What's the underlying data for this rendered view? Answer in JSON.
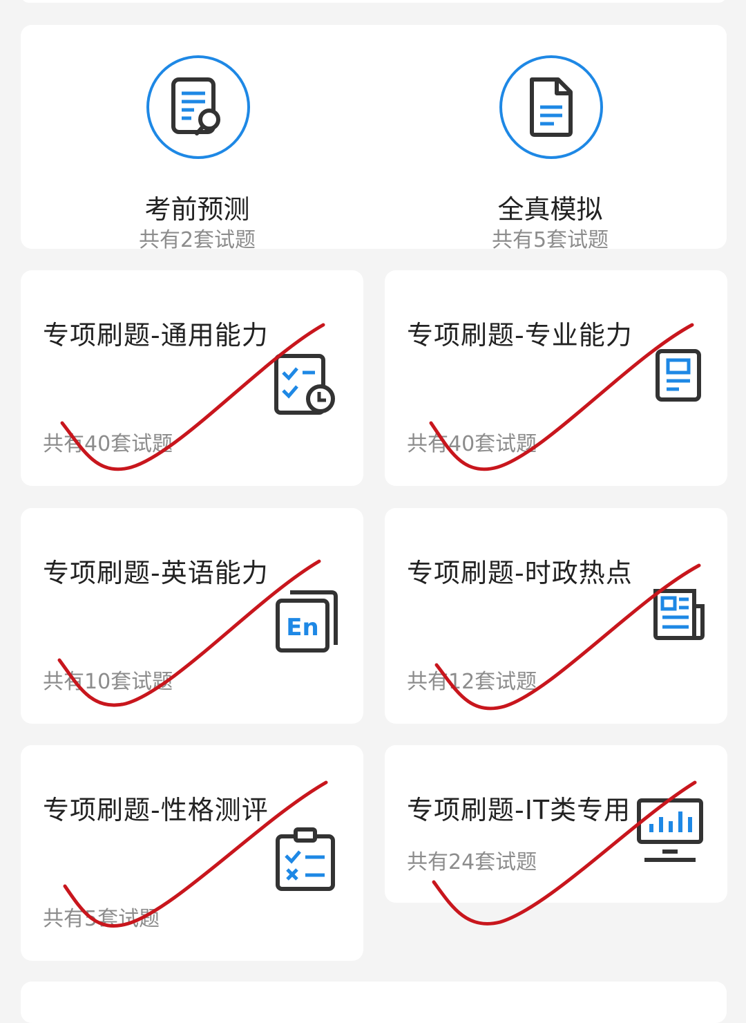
{
  "featured": [
    {
      "title": "考前预测",
      "sub": "共有2套试题",
      "icon": "document-search-icon"
    },
    {
      "title": "全真模拟",
      "sub": "共有5套试题",
      "icon": "document-icon"
    }
  ],
  "tiles": [
    {
      "title": "专项刷题-通用能力",
      "count": "共有40套试题",
      "icon": "checklist-clock-icon"
    },
    {
      "title": "专项刷题-专业能力",
      "count": "共有40套试题",
      "icon": "document-text-icon"
    },
    {
      "title": "专项刷题-英语能力",
      "count": "共有10套试题",
      "icon": "english-icon",
      "icon_text": "En"
    },
    {
      "title": "专项刷题-时政热点",
      "count": "共有12套试题",
      "icon": "newspaper-icon"
    },
    {
      "title": "专项刷题-性格测评",
      "count": "共有5套试题",
      "icon": "checklist-clipboard-icon"
    },
    {
      "title": "专项刷题-IT类专用",
      "count": "共有24套试题",
      "icon": "monitor-chart-icon"
    }
  ],
  "colors": {
    "accent": "#1e88e5",
    "icon_dark": "#333333",
    "annotation": "#c8161d",
    "muted": "#8c8c8c"
  }
}
